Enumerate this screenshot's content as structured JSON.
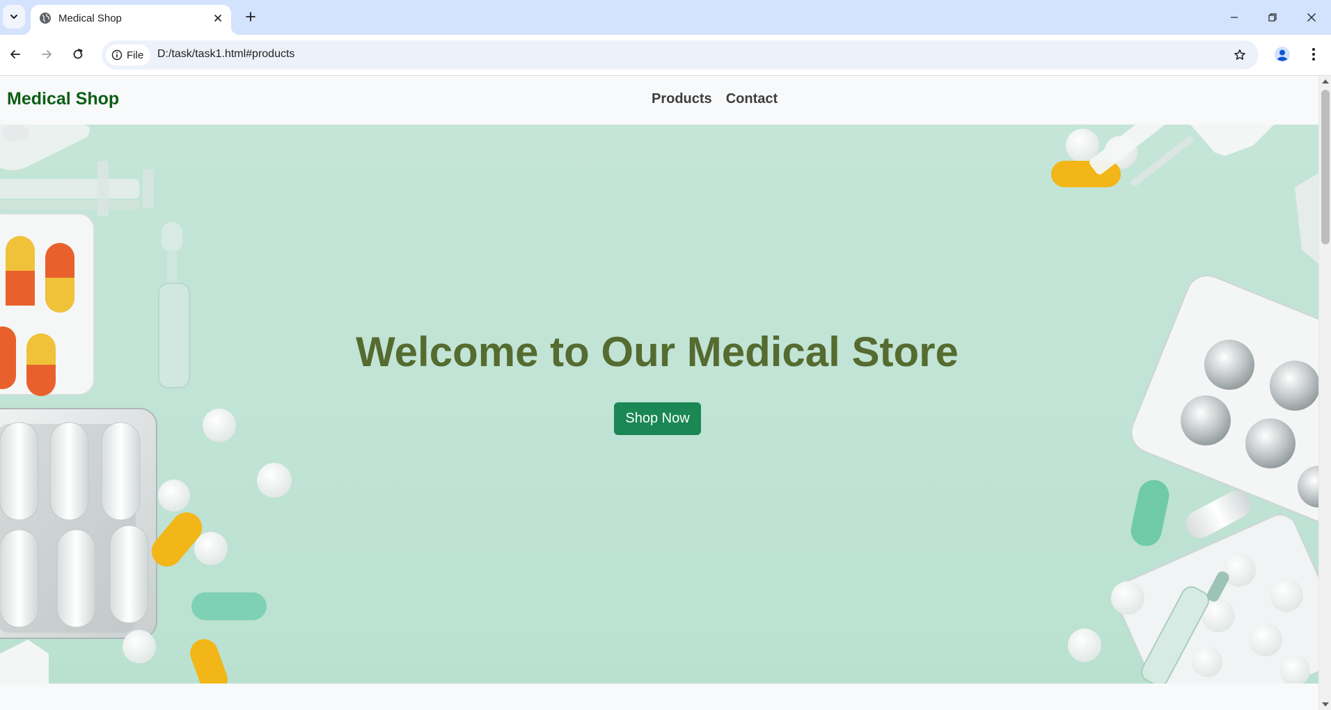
{
  "browser": {
    "tab_title": "Medical Shop",
    "omnibox": {
      "chip_label": "File",
      "url": "D:/task/task1.html#products"
    },
    "icons": {
      "tab_search": "chevron-down-icon",
      "favicon": "globe-icon",
      "tab_close": "close-icon",
      "new_tab": "plus-icon",
      "back": "arrow-left-icon",
      "forward": "arrow-right-icon",
      "reload": "reload-icon",
      "site_info": "info-icon",
      "bookmark": "star-icon",
      "profile": "profile-icon",
      "menu": "kebab-menu-icon",
      "minimize": "minimize-icon",
      "restore": "restore-icon",
      "close_window": "close-icon"
    }
  },
  "page": {
    "navbar": {
      "brand": "Medical Shop",
      "links": [
        "Products",
        "Contact"
      ]
    },
    "hero": {
      "title": "Welcome to Our Medical Store",
      "button": "Shop Now"
    }
  },
  "colors": {
    "brand": "#0c5e16",
    "hero_title": "#556b2f",
    "button_bg": "#1a8754",
    "hero_bg": "#bfe3d4",
    "tab_strip": "#d3e3fd"
  }
}
